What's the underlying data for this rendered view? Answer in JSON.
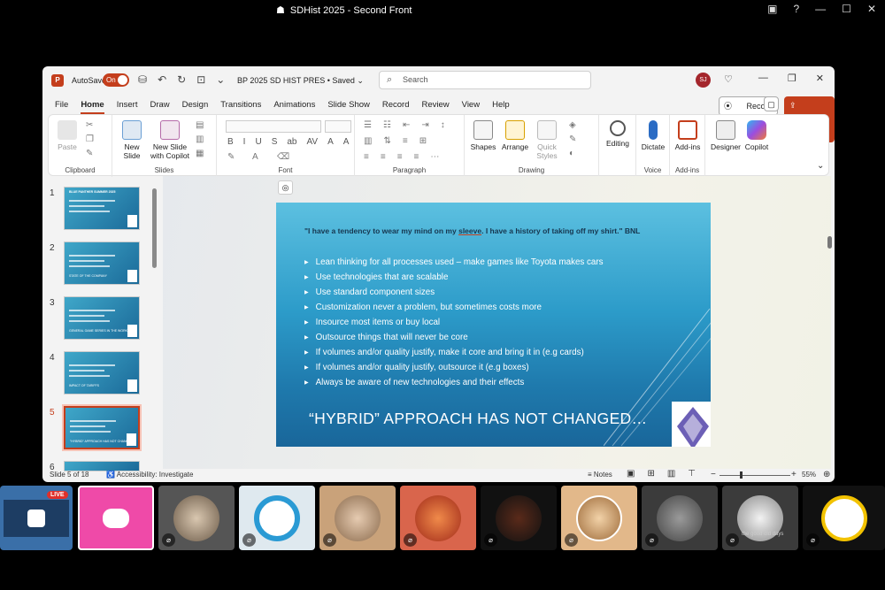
{
  "window_title": "SDHist 2025 - Second Front",
  "app": {
    "autosave_label": "AutoSave",
    "autosave_state": "On",
    "doc_title": "BP 2025 SD HIST PRES • Saved",
    "doc_chevron": "⌄",
    "search_placeholder": "Search",
    "avatar_initials": "SJ"
  },
  "menu": {
    "tabs": [
      "File",
      "Home",
      "Insert",
      "Draw",
      "Design",
      "Transitions",
      "Animations",
      "Slide Show",
      "Record",
      "Review",
      "View",
      "Help"
    ],
    "record_label": "Record",
    "share_label": "Share"
  },
  "ribbon": {
    "clipboard": {
      "paste": "Paste",
      "label": "Clipboard"
    },
    "slides": {
      "new_slide": "New Slide",
      "new_slide_copilot_1": "New Slide",
      "new_slide_copilot_2": "with Copilot",
      "label": "Slides"
    },
    "font": {
      "label": "Font",
      "buttons": [
        "B",
        "I",
        "U",
        "S",
        "ab",
        "AV",
        "A",
        "A"
      ]
    },
    "paragraph": {
      "label": "Paragraph"
    },
    "drawing": {
      "shapes": "Shapes",
      "arrange": "Arrange",
      "quick_styles_1": "Quick",
      "quick_styles_2": "Styles",
      "label": "Drawing"
    },
    "editing": {
      "label": "Editing"
    },
    "voice": {
      "dictate": "Dictate",
      "label": "Voice"
    },
    "addins": {
      "addins": "Add-ins",
      "label": "Add-ins"
    },
    "designer": "Designer",
    "copilot": "Copilot"
  },
  "thumbnails": [
    {
      "num": "1",
      "title": "BLUE PANTHER SUMMER 2025",
      "caption": ""
    },
    {
      "num": "2",
      "title": "",
      "caption": "STATE OF THE COMPANY"
    },
    {
      "num": "3",
      "title": "",
      "caption": "GENERAL GAME SERIES IN THE WORKS"
    },
    {
      "num": "4",
      "title": "",
      "caption": "IMPACT OF TARIFFS"
    },
    {
      "num": "5",
      "title": "",
      "caption": "\"HYBRID\" APPROACH HAS NOT CHANGED"
    },
    {
      "num": "6",
      "title": "",
      "caption": ""
    }
  ],
  "slide": {
    "quote_pre": "\"I have a tendency to wear my mind on my ",
    "quote_sleeve": "sleeve",
    "quote_post": ". I have a history of taking off my shirt.\"  BNL",
    "bullets": [
      "Lean thinking for all processes used – make games like Toyota makes cars",
      "Use technologies that are scalable",
      "Use standard component sizes",
      "Customization never a problem, but sometimes costs  more",
      "Insource most items or buy local",
      "Outsource things that will never be core",
      "If volumes and/or quality justify, make it core and bring it in (e.g cards)",
      "If volumes and/or quality justify, outsource it (e.g boxes)",
      "Always be aware of new technologies and their effects"
    ],
    "heading": "“HYBRID” APPROACH HAS NOT CHANGED…"
  },
  "status": {
    "slide_of": "Slide 5 of 18",
    "accessibility": "Accessibility: Investigate",
    "notes": "Notes",
    "zoom": "55%"
  },
  "participants": {
    "live_badge": "LIVE",
    "tile_caption": "the good old days"
  },
  "colors": {
    "accent": "#c43e1c",
    "slide_top": "#5cc0e0",
    "slide_bottom": "#19669a",
    "discord": "#ef4aa8"
  }
}
